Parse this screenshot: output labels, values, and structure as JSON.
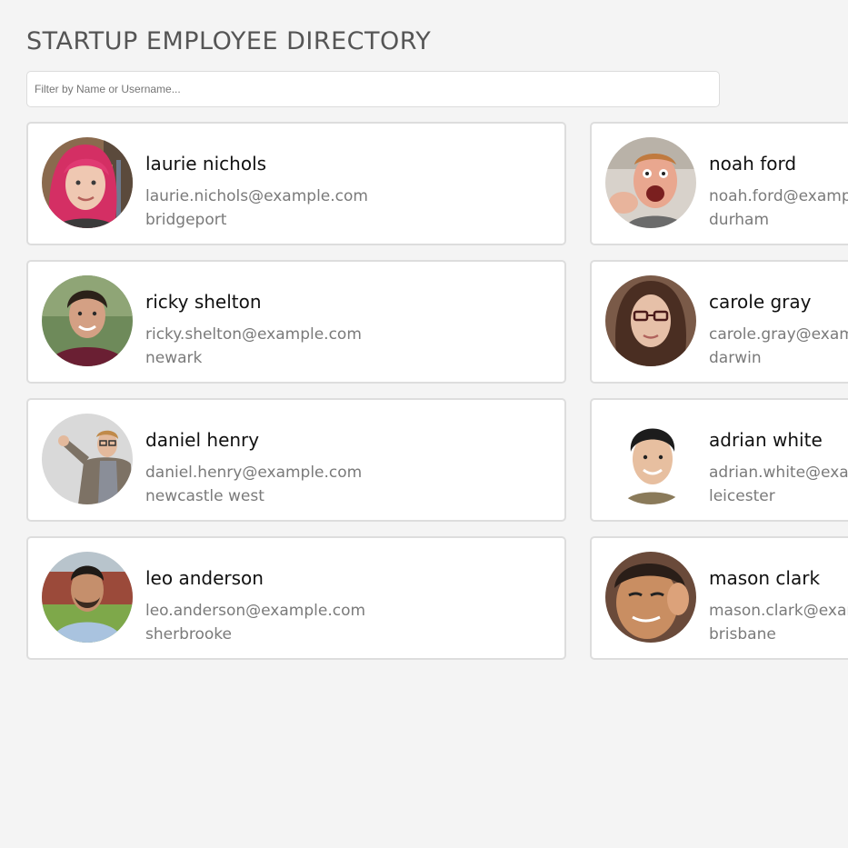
{
  "header": {
    "title": "STARTUP EMPLOYEE DIRECTORY"
  },
  "search": {
    "placeholder": "Filter by Name or Username...",
    "value": ""
  },
  "employees": [
    {
      "name": "laurie nichols",
      "email": "laurie.nichols@example.com",
      "city": "bridgeport",
      "avatar": "laurie-nichols-photo"
    },
    {
      "name": "noah ford",
      "email": "noah.ford@example.com",
      "city": "durham",
      "avatar": "noah-ford-photo"
    },
    {
      "name": "ricky shelton",
      "email": "ricky.shelton@example.com",
      "city": "newark",
      "avatar": "ricky-shelton-photo"
    },
    {
      "name": "carole gray",
      "email": "carole.gray@example.com",
      "city": "darwin",
      "avatar": "carole-gray-photo"
    },
    {
      "name": "daniel henry",
      "email": "daniel.henry@example.com",
      "city": "newcastle west",
      "avatar": "daniel-henry-photo"
    },
    {
      "name": "adrian white",
      "email": "adrian.white@example.com",
      "city": "leicester",
      "avatar": "adrian-white-photo"
    },
    {
      "name": "leo anderson",
      "email": "leo.anderson@example.com",
      "city": "sherbrooke",
      "avatar": "leo-anderson-photo"
    },
    {
      "name": "mason clark",
      "email": "mason.clark@example.com",
      "city": "brisbane",
      "avatar": "mason-clark-photo"
    }
  ]
}
